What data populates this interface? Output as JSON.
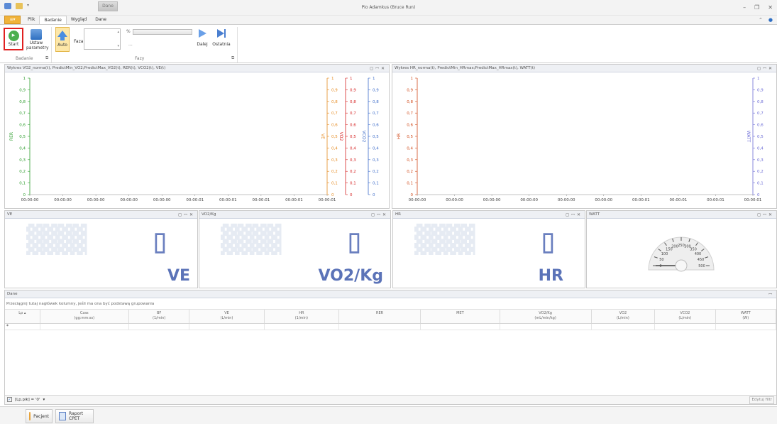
{
  "window": {
    "title": "Pio Adamkus (Bruce Run)",
    "context_tab": "Dane"
  },
  "ribbon_tabs": {
    "file": "Plik",
    "tabs": [
      "Badanie",
      "Wygląd",
      "Dane"
    ],
    "active": "Badanie"
  },
  "ribbon": {
    "start_label": "Start",
    "params_label_1": "Ustaw",
    "params_label_2": "parametry",
    "auto_label": "Auto",
    "faza_label": "Faza",
    "ellipsis": "...",
    "next_label": "Dalej",
    "last_label": "Ostatnia",
    "group_badanie": "Badanie",
    "group_fazy": "Fazy"
  },
  "chart_data": [
    {
      "type": "line",
      "title": "Wykres VO2_norma(t), PredictMin_VO2;PredictMax_VO2(t), RER(t), VCO2(t), VE(t)",
      "x_ticks": [
        "00:00:00",
        "00:00:00",
        "00:00:00",
        "00:00:00",
        "00:00:00",
        "00:00:01",
        "00:00:01",
        "00:00:01",
        "00:00:01",
        "00:00:01"
      ],
      "y_ticks": [
        "0",
        "0,1",
        "0,2",
        "0,3",
        "0,4",
        "0,5",
        "0,6",
        "0,7",
        "0,8",
        "0,9",
        "1"
      ],
      "left_axis": {
        "label": "RER",
        "color": "#2e9e2e"
      },
      "right_axes": [
        {
          "label": "VE",
          "color": "#e58a1f"
        },
        {
          "label": "VO2",
          "color": "#d62424"
        },
        {
          "label": "VCO2",
          "color": "#3d6cc9"
        }
      ],
      "ylim": [
        0,
        1
      ],
      "grid": false,
      "series": []
    },
    {
      "type": "line",
      "title": "Wykres HR_norma(t), PredictMin_HRmax;PredictMax_HRmax(t), WATT(t)",
      "x_ticks": [
        "00:00:00",
        "00:00:00",
        "00:00:00",
        "00:00:00",
        "00:00:00",
        "00:00:00",
        "00:00:01",
        "00:00:01",
        "00:00:01",
        "00:00:01"
      ],
      "y_ticks": [
        "0",
        "0,1",
        "0,2",
        "0,3",
        "0,4",
        "0,5",
        "0,6",
        "0,7",
        "0,8",
        "0,9",
        "1"
      ],
      "left_axis": {
        "label": "HR",
        "color": "#d04a1a"
      },
      "right_axes": [
        {
          "label": "WATT",
          "color": "#6b6bd6"
        }
      ],
      "ylim": [
        0,
        1
      ],
      "grid": false,
      "series": []
    }
  ],
  "indicators": {
    "ve": {
      "header": "VE",
      "unit": "VE"
    },
    "vo2kg": {
      "header": "VO2/Kg",
      "unit": "VO2/Kg"
    },
    "hr": {
      "header": "HR",
      "unit": "HR"
    },
    "watt": {
      "header": "WATT",
      "gauge_ticks": [
        "0",
        "50",
        "100",
        "150",
        "200",
        "250",
        "300",
        "350",
        "400",
        "450",
        "500"
      ]
    }
  },
  "grid": {
    "header": "Dane",
    "group_hint": "Przeciągnij tutaj nagłówek kolumny, jeśli ma ona być podstawą grupowania",
    "columns": [
      {
        "l1": "Lp",
        "l2": ""
      },
      {
        "l1": "Czas",
        "l2": "(gg:mm:ss)"
      },
      {
        "l1": "BF",
        "l2": "(1/min)"
      },
      {
        "l1": "VE",
        "l2": "(L/min)"
      },
      {
        "l1": "HR",
        "l2": "(1/min)"
      },
      {
        "l1": "RER",
        "l2": ""
      },
      {
        "l1": "MET",
        "l2": ""
      },
      {
        "l1": "VO2/Kg",
        "l2": "(mL/min/kg)"
      },
      {
        "l1": "VO2",
        "l2": "(L/min)"
      },
      {
        "l1": "VCO2",
        "l2": "(L/min)"
      },
      {
        "l1": "WATT",
        "l2": "(W)"
      }
    ],
    "filter_text": "[Lp.pik] = '0'",
    "edit_filter": "Edytuj filtr"
  },
  "bottom": {
    "patient": "Pacjent",
    "report": "Raport CPET"
  }
}
